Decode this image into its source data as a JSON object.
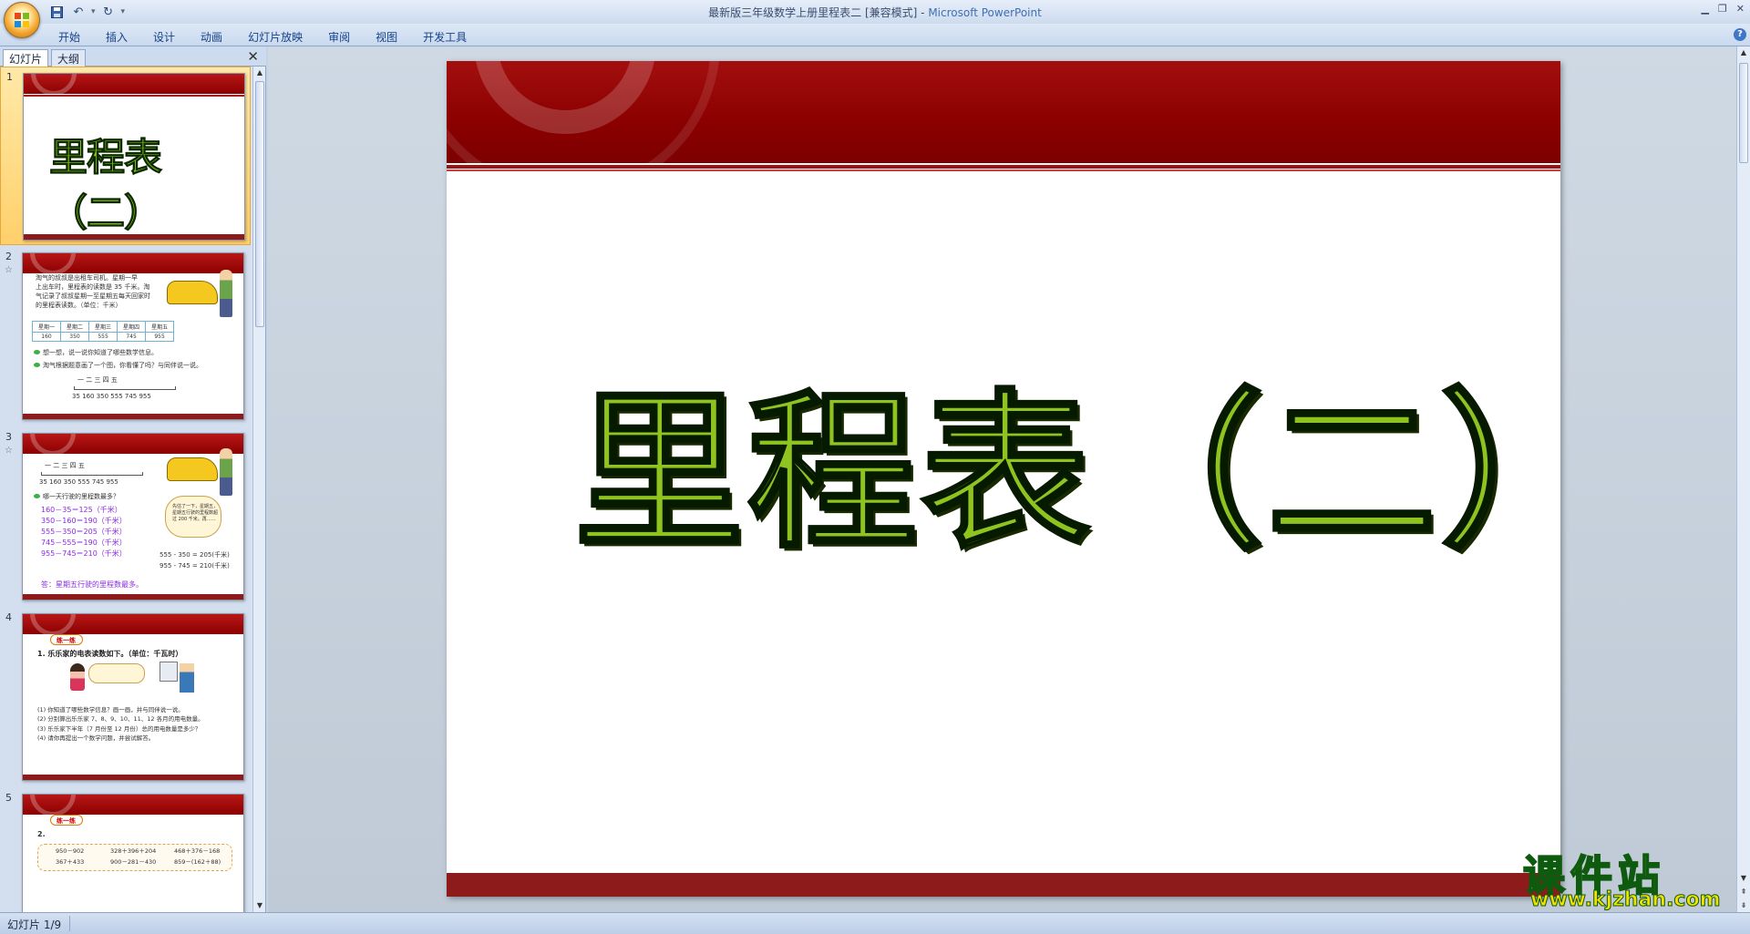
{
  "window": {
    "title": "最新版三年级数学上册里程表二 [兼容模式]",
    "title_sep": " - ",
    "app_name": "Microsoft PowerPoint"
  },
  "quick_access": {
    "dropdown": "▾"
  },
  "ribbon": {
    "tabs": [
      "开始",
      "插入",
      "设计",
      "动画",
      "幻灯片放映",
      "审阅",
      "视图",
      "开发工具"
    ]
  },
  "panel": {
    "tab_slides": "幻灯片",
    "tab_outline": "大纲"
  },
  "thumbnails": {
    "s1": {
      "num": "1",
      "title": "里程表（二）"
    },
    "s2": {
      "num": "2",
      "text_lines": [
        "淘气的叔叔是出租车司机。星期一早",
        "上出车时，里程表的读数是 35 千米。淘",
        "气记录了叔叔星期一至星期五每天回家时",
        "的里程表读数。（单位：千米）"
      ],
      "days": [
        "星期一",
        "星期二",
        "星期三",
        "星期四",
        "星期五"
      ],
      "readings": [
        "160",
        "350",
        "555",
        "745",
        "955"
      ],
      "bullet1": "想一想，说一说你知道了哪些数学信息。",
      "bullet2": "淘气根据题意画了一个图，你看懂了吗？与同伴说一说。",
      "axis_days": "一    二    三    四    五",
      "axis_nums": "35  160   350   555  745   955"
    },
    "s3": {
      "num": "3",
      "axis_days": "一    二    三    四    五",
      "axis_nums": "35  160   350   555  745   955",
      "question": "哪一天行驶的里程数最多？",
      "calc": [
        "160－35＝125（千米）",
        "350－160＝190（千米）",
        "555－350＝205（千米）",
        "745－555＝190（千米）",
        "955－745＝210（千米）"
      ],
      "answer": "答：星期五行驶的里程数最多。",
      "bubble": "先估了一下，星期五，星期五行驶的里程数超过 200 千米。再……",
      "hand1": "555 - 350 = 205(千米)",
      "hand2": "955 - 745 = 210(千米)"
    },
    "s4": {
      "num": "4",
      "badge": "练一练",
      "heading": "1. 乐乐家的电表读数如下。（单位：千瓦时）",
      "lines": [
        "(1) 你知道了哪些数学信息？画一画，并与同伴说一说。",
        "(2) 分别算出乐乐家 7、8、9、10、11、12 各月的用电数量。",
        "(3) 乐乐家下半年（7 月份至 12 月份）总的用电数量是多少？",
        "(4) 请你再提出一个数学问题，并尝试解答。"
      ]
    },
    "s5": {
      "num": "5",
      "badge": "练一练",
      "num_label": "2.",
      "row1": [
        "950－902",
        "328＋396＋204",
        "468＋376－168"
      ],
      "row2": [
        "367＋433",
        "900－281－430",
        "859－(162＋88)"
      ]
    }
  },
  "slide": {
    "title": "里程表（二）"
  },
  "watermark": {
    "brand": "课件站",
    "url": "www.kjzhan.com"
  },
  "status": {
    "slide_info": "幻灯片 1/9"
  }
}
